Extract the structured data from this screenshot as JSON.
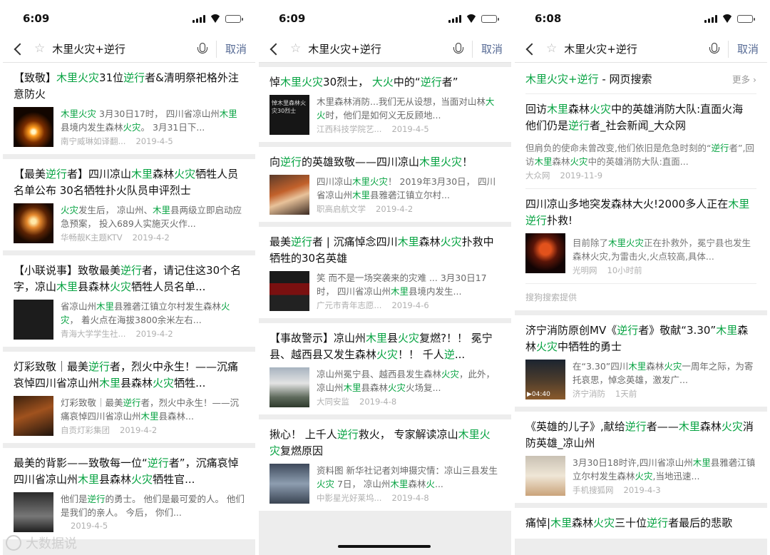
{
  "phones": [
    {
      "time": "6:09",
      "query": "木里火灾+逆行",
      "cancel": "取消",
      "cards": [
        {
          "title": [
            [
              "【致敬】",
              ""
            ],
            [
              "木里火灾",
              "hl"
            ],
            [
              "31位",
              ""
            ],
            [
              "逆行",
              "hl"
            ],
            [
              "者&清明祭祀格外注意防火",
              ""
            ]
          ],
          "snip": [
            [
              "木里火灾",
              "hl"
            ],
            [
              " 3月30日17时， 四川省凉山州",
              ""
            ],
            [
              "木里",
              "hl"
            ],
            [
              "县境内发生森林",
              ""
            ],
            [
              "火灾",
              "hl"
            ],
            [
              "。 3月31日下...",
              ""
            ]
          ],
          "source": "南宁威琳如译翻...",
          "date": "2019-4-5",
          "thumb": "candle"
        },
        {
          "title": [
            [
              "【最美",
              ""
            ],
            [
              "逆行",
              "hl"
            ],
            [
              "者】四川凉山",
              ""
            ],
            [
              "木里",
              "hl"
            ],
            [
              "森林",
              ""
            ],
            [
              "火灾",
              "hl"
            ],
            [
              "牺牲人员名单公布 30名牺牲扑火队员申评烈士",
              ""
            ]
          ],
          "snip": [
            [
              "火灾",
              "hl"
            ],
            [
              "发生后， 凉山州、",
              ""
            ],
            [
              "木里",
              "hl"
            ],
            [
              "县两级立即启动应急预案， 投入689人实施灭火作...",
              ""
            ]
          ],
          "source": "华畅靓K主题KTV",
          "date": "2019-4-2",
          "thumb": "candle2"
        },
        {
          "title": [
            [
              "【小联说事】致敬最美",
              ""
            ],
            [
              "逆行",
              "hl"
            ],
            [
              "者，请记住这30个名字，凉山",
              ""
            ],
            [
              "木里",
              "hl"
            ],
            [
              "县森林",
              ""
            ],
            [
              "火灾",
              "hl"
            ],
            [
              "牺牲人员名单...",
              ""
            ]
          ],
          "snip": [
            [
              "省凉山州",
              ""
            ],
            [
              "木里",
              "hl"
            ],
            [
              "县雅砻江镇立尔村发生森林",
              ""
            ],
            [
              "火灾",
              "hl"
            ],
            [
              "， 着火点在海拔3800余米左右...",
              ""
            ]
          ],
          "source": "青海大学学生社...",
          "date": "2019-4-2",
          "thumb": "calli"
        },
        {
          "title": [
            [
              "灯彩致敬｜最美",
              ""
            ],
            [
              "逆行",
              "hl"
            ],
            [
              "者，烈火中永生！——沉痛哀悼四川省凉山州",
              ""
            ],
            [
              "木里",
              "hl"
            ],
            [
              "县森林",
              ""
            ],
            [
              "火灾",
              "hl"
            ],
            [
              "牺牲...",
              ""
            ]
          ],
          "snip": [
            [
              "灯彩致敬｜最美",
              ""
            ],
            [
              "逆行",
              "hl"
            ],
            [
              "者，烈火中永生！——沉痛哀悼四川省凉山州",
              ""
            ],
            [
              "木里",
              "hl"
            ],
            [
              "县森林...",
              ""
            ]
          ],
          "source": "自贡灯彩集团",
          "date": "2019-4-2",
          "thumb": "lanterns"
        },
        {
          "title": [
            [
              "最美的背影——致敬每一位“",
              ""
            ],
            [
              "逆行",
              "hl"
            ],
            [
              "者”，沉痛哀悼四川省凉山州",
              ""
            ],
            [
              "木里",
              "hl"
            ],
            [
              "县森林",
              ""
            ],
            [
              "火灾",
              "hl"
            ],
            [
              "牺牲官...",
              ""
            ]
          ],
          "snip": [
            [
              "他们是",
              ""
            ],
            [
              "逆行",
              "hl"
            ],
            [
              "的勇士。 他们是最可爱的人。 他们是我们的亲人。 今后， 你们...",
              ""
            ]
          ],
          "source": "",
          "date": "2019-4-5",
          "thumb": "dark"
        }
      ]
    },
    {
      "time": "6:09",
      "query": "木里火灾+逆行",
      "cancel": "取消",
      "cards": [
        {
          "title": [
            [
              "悼",
              ""
            ],
            [
              "木里火灾",
              "hl"
            ],
            [
              "30烈士， ",
              ""
            ],
            [
              "大火",
              "hl"
            ],
            [
              "中的“",
              ""
            ],
            [
              "逆行",
              "hl"
            ],
            [
              "者”",
              ""
            ]
          ],
          "snip": [
            [
              "木里森林消防...我们无从设想，当面对山林",
              ""
            ],
            [
              "大火",
              "hl"
            ],
            [
              "时，他们是如何义无反顾地...",
              ""
            ]
          ],
          "source": "江西科技学院艺...",
          "date": "2019-4-5",
          "thumb": "text30",
          "thumb_text": "悼木里森林火灾30烈士"
        },
        {
          "title": [
            [
              "向",
              ""
            ],
            [
              "逆行",
              "hl"
            ],
            [
              "的英雄致敬——四川凉山",
              ""
            ],
            [
              "木里火灾",
              "hl"
            ],
            [
              "！",
              ""
            ]
          ],
          "snip": [
            [
              "四川凉山",
              ""
            ],
            [
              "木里火灾",
              "hl"
            ],
            [
              "！ 2019年3月30日， 四川省凉山州",
              ""
            ],
            [
              "木里",
              "hl"
            ],
            [
              "县雅砻江镇立尔村...",
              ""
            ]
          ],
          "source": "职高启航文学",
          "date": "2019-4-2",
          "thumb": "fire"
        },
        {
          "title": [
            [
              "最美",
              ""
            ],
            [
              "逆行",
              "hl"
            ],
            [
              "者 | 沉痛悼念四川",
              ""
            ],
            [
              "木里",
              "hl"
            ],
            [
              "森林",
              ""
            ],
            [
              "火灾",
              "hl"
            ],
            [
              "扑救中牺牲的30名英雄",
              ""
            ]
          ],
          "snip": [
            [
              "笑 而不是一场突袭来的灾难 ... 3月30日17时， 四川省凉山州",
              ""
            ],
            [
              "木里",
              "hl"
            ],
            [
              "县境内发生...",
              ""
            ]
          ],
          "source": "广元市青年志愿...",
          "date": "2019-4-6",
          "thumb": "banner"
        },
        {
          "title": [
            [
              "【事故警示】凉山州",
              ""
            ],
            [
              "木里",
              "hl"
            ],
            [
              "县",
              ""
            ],
            [
              "火灾",
              "hl"
            ],
            [
              "复燃?！！ 冕宁县、越西县又发生森林",
              ""
            ],
            [
              "火灾",
              "hl"
            ],
            [
              "！！ 千人",
              ""
            ],
            [
              "逆",
              "hl"
            ],
            [
              "...",
              ""
            ]
          ],
          "snip": [
            [
              "凉山州冕宁县、越西县发生森林",
              ""
            ],
            [
              "火灾",
              "hl"
            ],
            [
              "，此外， 凉山州",
              ""
            ],
            [
              "木里",
              "hl"
            ],
            [
              "县森林",
              ""
            ],
            [
              "火灾",
              "hl"
            ],
            [
              "火场复...",
              ""
            ]
          ],
          "source": "大同安监",
          "date": "2019-4-8",
          "thumb": "smoke"
        },
        {
          "title": [
            [
              "揪心！ 上千人",
              ""
            ],
            [
              "逆行",
              "hl"
            ],
            [
              "救火， 专家解读凉山",
              ""
            ],
            [
              "木里火灾",
              "hl"
            ],
            [
              "复燃原因",
              ""
            ]
          ],
          "snip": [
            [
              "资料图 新华社记者刘坤摄灾情：凉山三县发生",
              ""
            ],
            [
              "火灾",
              "hl"
            ],
            [
              " 7日， 凉山州",
              ""
            ],
            [
              "木里",
              "hl"
            ],
            [
              "森林",
              ""
            ],
            [
              "火",
              "hl"
            ],
            [
              "...",
              ""
            ]
          ],
          "source": "中影星光好莱坞...",
          "date": "2019-4-8",
          "thumb": "sky"
        }
      ]
    },
    {
      "time": "6:08",
      "query": "木里火灾+逆行",
      "cancel": "取消",
      "web_header": {
        "query": "木里火灾+逆行",
        "suffix": " - 网页搜索",
        "more": "更多"
      },
      "web_results": [
        {
          "title": [
            [
              "回访",
              ""
            ],
            [
              "木里",
              "hl"
            ],
            [
              "森林",
              ""
            ],
            [
              "火灾",
              "hl"
            ],
            [
              "中的英雄消防大队:直面火海 他们仍是",
              ""
            ],
            [
              "逆行",
              "hl"
            ],
            [
              "者_社会新闻_大众网",
              ""
            ]
          ],
          "snip": [
            [
              "但肩负的使命未曾改变,他们依旧是危急时刻的“",
              ""
            ],
            [
              "逆行",
              "hl"
            ],
            [
              "者”,回访",
              ""
            ],
            [
              "木里",
              "hl"
            ],
            [
              "森林",
              ""
            ],
            [
              "火灾",
              "hl"
            ],
            [
              "中的英雄消防大队:直面...",
              ""
            ]
          ],
          "source": "大众网",
          "date": "2019-11-9"
        },
        {
          "title": [
            [
              "四川凉山多地突发森林大火!2000多人正在",
              ""
            ],
            [
              "木里逆行",
              "hl"
            ],
            [
              "扑救!",
              ""
            ]
          ],
          "snip": [
            [
              "目前除了",
              ""
            ],
            [
              "木里火灾",
              "hl"
            ],
            [
              "正在扑救外，冕宁县也发生森林火灾,为雷击火,火点较高,具体...",
              ""
            ]
          ],
          "source": "光明网",
          "date": "10小时前",
          "thumb": "firefighters"
        }
      ],
      "provider": "搜狗搜索提供",
      "cards": [
        {
          "title": [
            [
              "济宁消防原创MV《",
              ""
            ],
            [
              "逆行",
              "hl"
            ],
            [
              "者》敬献“3.30”",
              ""
            ],
            [
              "木里",
              "hl"
            ],
            [
              "森林",
              ""
            ],
            [
              "火灾",
              "hl"
            ],
            [
              "中牺牲的勇士",
              ""
            ]
          ],
          "snip": [
            [
              "在“3.30”四川",
              ""
            ],
            [
              "木里",
              "hl"
            ],
            [
              "森林",
              ""
            ],
            [
              "火灾",
              "hl"
            ],
            [
              "一周年之际，为寄托哀思，悼念英雄，激发广...",
              ""
            ]
          ],
          "source": "济宁消防",
          "date": "1天前",
          "thumb": "video",
          "duration": "▶04:40"
        },
        {
          "title": [
            [
              "《英雄的儿子》,献给",
              ""
            ],
            [
              "逆行",
              "hl"
            ],
            [
              "者——",
              ""
            ],
            [
              "木里",
              "hl"
            ],
            [
              "森林",
              ""
            ],
            [
              "火灾",
              "hl"
            ],
            [
              "消防英雄_凉山州",
              ""
            ]
          ],
          "snip": [
            [
              "3月30日18时许,四川省凉山州",
              ""
            ],
            [
              "木里",
              "hl"
            ],
            [
              "县雅砻江镇立尔村发生森林",
              ""
            ],
            [
              "火灾",
              "hl"
            ],
            [
              ",当地迅速...",
              ""
            ]
          ],
          "source": "手机搜狐网",
          "date": "2019-4-3",
          "thumb": "monument"
        },
        {
          "title": [
            [
              "痛悼|",
              ""
            ],
            [
              "木里",
              "hl"
            ],
            [
              "森林",
              ""
            ],
            [
              "火灾",
              "hl"
            ],
            [
              "三十位",
              ""
            ],
            [
              "逆行",
              "hl"
            ],
            [
              "者最后的悲歌",
              ""
            ]
          ],
          "snip": [],
          "source": "",
          "date": "",
          "thumb": ""
        }
      ]
    }
  ],
  "watermark": "大数据说"
}
